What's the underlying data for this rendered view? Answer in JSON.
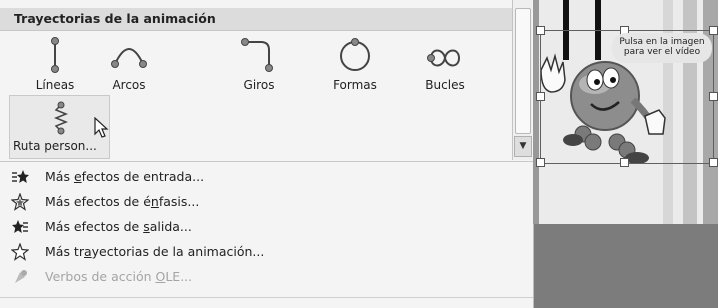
{
  "gallery": {
    "header": "Trayectorias de la animación",
    "items": [
      {
        "label": "Líneas",
        "icon": "line-path-icon"
      },
      {
        "label": "Arcos",
        "icon": "arc-path-icon"
      },
      {
        "label": "Giros",
        "icon": "turn-path-icon"
      },
      {
        "label": "Formas",
        "icon": "shape-path-icon"
      },
      {
        "label": "Bucles",
        "icon": "loop-path-icon"
      }
    ],
    "custom": {
      "label": "Ruta person...",
      "icon": "custom-path-icon"
    }
  },
  "menu": {
    "items": [
      {
        "prefix": "Más ",
        "key": "e",
        "suffix": "fectos de entrada...",
        "icon": "entrance-effect-icon",
        "disabled": false
      },
      {
        "prefix": "Más efectos de é",
        "key": "n",
        "suffix": "fasis...",
        "icon": "emphasis-effect-icon",
        "disabled": false
      },
      {
        "prefix": "Más efectos de ",
        "key": "s",
        "suffix": "alida...",
        "icon": "exit-effect-icon",
        "disabled": false
      },
      {
        "prefix": "Más tr",
        "key": "a",
        "suffix": "yectorias de la animación...",
        "icon": "motion-path-icon",
        "disabled": false
      },
      {
        "prefix": "Verbos de acción ",
        "key": "O",
        "suffix": "LE...",
        "icon": "ole-verbs-icon",
        "disabled": true
      }
    ]
  },
  "slide": {
    "tooltip_line1": "Pulsa en la imagen",
    "tooltip_line2": "para ver el vídeo"
  },
  "colors": {
    "panel_bg": "#f4f4f4",
    "header_bg": "#dcdcdc",
    "disabled_text": "#a4a4a4"
  }
}
